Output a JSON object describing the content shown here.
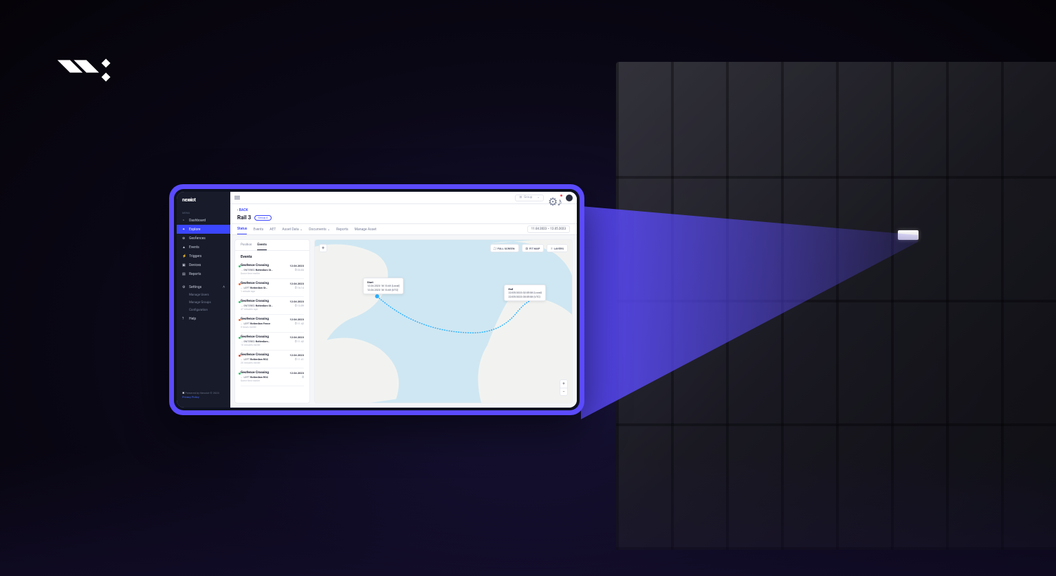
{
  "brand": "nexxiot",
  "sidebar": {
    "section_label": "MENU",
    "items": [
      {
        "label": "Dashboard"
      },
      {
        "label": "Explore"
      },
      {
        "label": "Geofences"
      },
      {
        "label": "Events"
      },
      {
        "label": "Triggers"
      },
      {
        "label": "Devices"
      },
      {
        "label": "Reports"
      }
    ],
    "settings_label": "Settings",
    "settings_items": [
      {
        "label": "Manage Users"
      },
      {
        "label": "Manage Groups"
      },
      {
        "label": "Configuration"
      }
    ],
    "help_label": "Help",
    "footer_line": "Powered by Nexxiot © 2023",
    "footer_link": "Privacy Policy"
  },
  "topbar": {
    "search_placeholder": "Group"
  },
  "header": {
    "back": "BACK",
    "title": "Rail 3",
    "badge": "Group A"
  },
  "tabs": [
    "Status",
    "Events",
    "AET",
    "Asset Data",
    "Documents",
    "Reports",
    "Manage Asset"
  ],
  "date_range": "11.04.2023 – 12.05.2023",
  "panel": {
    "tabs": [
      "Position",
      "Events"
    ],
    "title": "Events",
    "events": [
      {
        "dot": "#2ecc71",
        "name": "Geofence Crossing",
        "date": "12.04.2023",
        "time": "03:03",
        "dir": "ENTERED",
        "loc": "Rotterdam St…",
        "since": "Some time earlier"
      },
      {
        "dot": "#ff6b35",
        "name": "Geofence Crossing",
        "date": "12.04.2023",
        "time": "16:14",
        "dir": "LEFT",
        "loc": "Rotterdam St…",
        "since": "1 minute ago"
      },
      {
        "dot": "#2ecc71",
        "name": "Geofence Crossing",
        "date": "12.04.2023",
        "time": "13:59",
        "dir": "ENTERED",
        "loc": "Rotterdam St…",
        "since": "47 minutes ago"
      },
      {
        "dot": "#ff6b35",
        "name": "Geofence Crossing",
        "date": "12.04.2023",
        "time": "11:42",
        "dir": "LEFT",
        "loc": "Rotterdam Fence",
        "since": "5 hours earlier"
      },
      {
        "dot": "#2ecc71",
        "name": "Geofence Crossing",
        "date": "12.04.2023",
        "time": "11:42",
        "dir": "ENTERED",
        "loc": "Rotterdam…",
        "since": "10 minutes earlier"
      },
      {
        "dot": "#e74c3c",
        "name": "Geofence Crossing",
        "date": "12.04.2023",
        "time": "11:41",
        "dir": "LEFT",
        "loc": "Rotterdam RSC",
        "since": "20 minutes earlier"
      },
      {
        "dot": "#2ecc71",
        "name": "Geofence Crossing",
        "date": "12.04.2023",
        "time": "",
        "dir": "LEFT",
        "loc": "Rotterdam RSC",
        "since": "Some time earlier"
      }
    ]
  },
  "map": {
    "buttons": {
      "fullscreen": "FULL SCREEN",
      "fitmap": "FIT MAP",
      "layers": "LAYERS"
    },
    "start": {
      "title": "Start",
      "line1": "12.04.2023 18:13:48 (Local)",
      "line2": "12.04.2023 18:13:48 (UTC)"
    },
    "end": {
      "title": "End",
      "line1": "22/05/2023 02:05:08 (Local)",
      "line2": "22/05/2023 00:05:08 (UTC)"
    }
  }
}
